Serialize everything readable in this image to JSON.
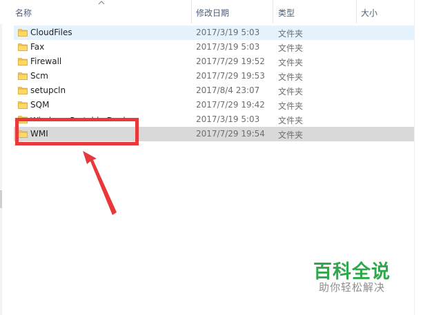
{
  "columns": {
    "name": "名称",
    "date": "修改日期",
    "type": "类型",
    "size": "大小"
  },
  "files": [
    {
      "name": "CloudFiles",
      "date": "2017/3/19 5:03",
      "type": "文件夹",
      "state": "hover"
    },
    {
      "name": "Fax",
      "date": "2017/3/19 5:03",
      "type": "文件夹",
      "state": "normal"
    },
    {
      "name": "Firewall",
      "date": "2017/7/29 19:52",
      "type": "文件夹",
      "state": "normal"
    },
    {
      "name": "Scm",
      "date": "2017/7/29 19:53",
      "type": "文件夹",
      "state": "normal"
    },
    {
      "name": "setupcln",
      "date": "2017/8/4 23:07",
      "type": "文件夹",
      "state": "normal"
    },
    {
      "name": "SQM",
      "date": "2017/7/29 19:42",
      "type": "文件夹",
      "state": "normal"
    },
    {
      "name": "Windows Portable Devices",
      "date": "2017/3/19 5:03",
      "type": "文件夹",
      "state": "partially-covered"
    },
    {
      "name": "WMI",
      "date": "2017/7/29 19:54",
      "type": "文件夹",
      "state": "selected"
    }
  ],
  "icons": {
    "folder": "folder-icon",
    "sort": "sort-ascending-icon"
  },
  "colors": {
    "hover_row": "#e5f3ff",
    "selected_row": "#d9d9d9",
    "annotation": "#e8383a",
    "folder": "#f5c75c",
    "watermark_title": "#2da84a"
  },
  "watermark": {
    "title": "百科全说",
    "subtitle": "助你轻松解决"
  }
}
